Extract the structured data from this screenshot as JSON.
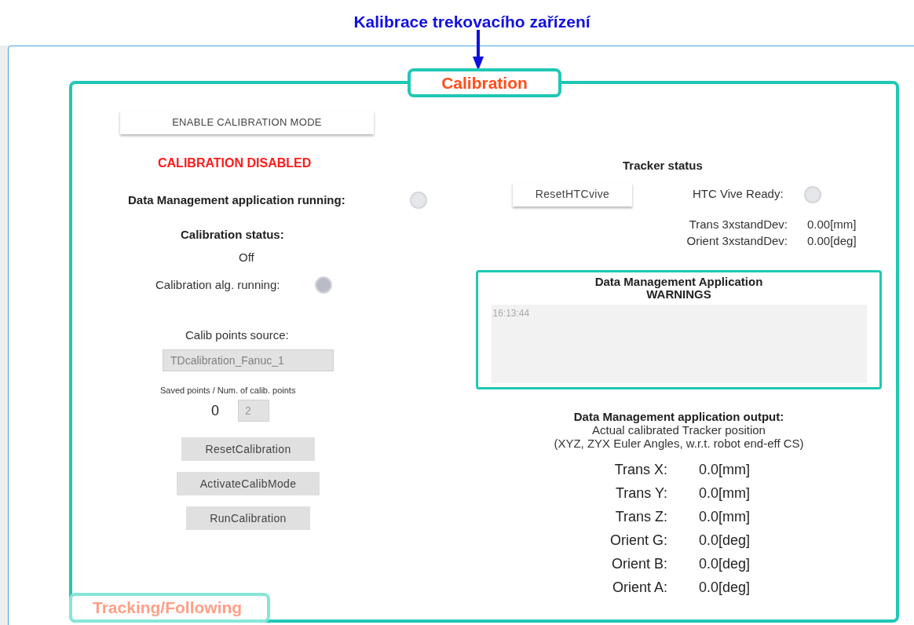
{
  "annotation": {
    "title": "Kalibrace trekovacího zařízení"
  },
  "panel": {
    "title": "Calibration",
    "footer_tab": "Tracking/Following"
  },
  "calibration": {
    "enable_button": "ENABLE CALIBRATION MODE",
    "mode_status": "CALIBRATION DISABLED",
    "app_running": {
      "label": "Data Management application running:",
      "on": false
    },
    "status_label": "Calibration status:",
    "status_value": "Off",
    "alg_running": {
      "label": "Calibration alg. running:",
      "on": false
    },
    "points_source": {
      "label": "Calib points source:",
      "value": "TDcalibration_Fanuc_1",
      "disabled": true
    },
    "points": {
      "label": "Saved points / Num. of calib. points",
      "saved": "0",
      "total": "2",
      "disabled": true
    },
    "buttons": [
      {
        "label": "ResetCalibration",
        "disabled": true
      },
      {
        "label": "ActivateCalibMode",
        "disabled": true
      },
      {
        "label": "RunCalibration",
        "disabled": true
      }
    ]
  },
  "tracker": {
    "title": "Tracker status",
    "reset_button": "ResetHTCvive",
    "ready": {
      "label": "HTC Vive Ready:",
      "on": false
    },
    "deviations": [
      {
        "label": "Trans 3xstandDev:",
        "value": "0.00[mm]"
      },
      {
        "label": "Orient 3xstandDev:",
        "value": "0.00[deg]"
      }
    ]
  },
  "warnings": {
    "title": "Data Management Application",
    "subtitle": "WARNINGS",
    "log": [
      "16:13:44"
    ]
  },
  "output": {
    "title": "Data Management application output:",
    "subtitle": "Actual calibrated Tracker position",
    "note": "(XYZ, ZYX Euler Angles, w.r.t. robot end-eff CS)",
    "rows": [
      {
        "label": "Trans X:",
        "value": "0.0[mm]"
      },
      {
        "label": "Trans Y:",
        "value": "0.0[mm]"
      },
      {
        "label": "Trans Z:",
        "value": "0.0[mm]"
      },
      {
        "label": "Orient G:",
        "value": "0.0[deg]"
      },
      {
        "label": "Orient B:",
        "value": "0.0[deg]"
      },
      {
        "label": "Orient A:",
        "value": "0.0[deg]"
      }
    ]
  }
}
